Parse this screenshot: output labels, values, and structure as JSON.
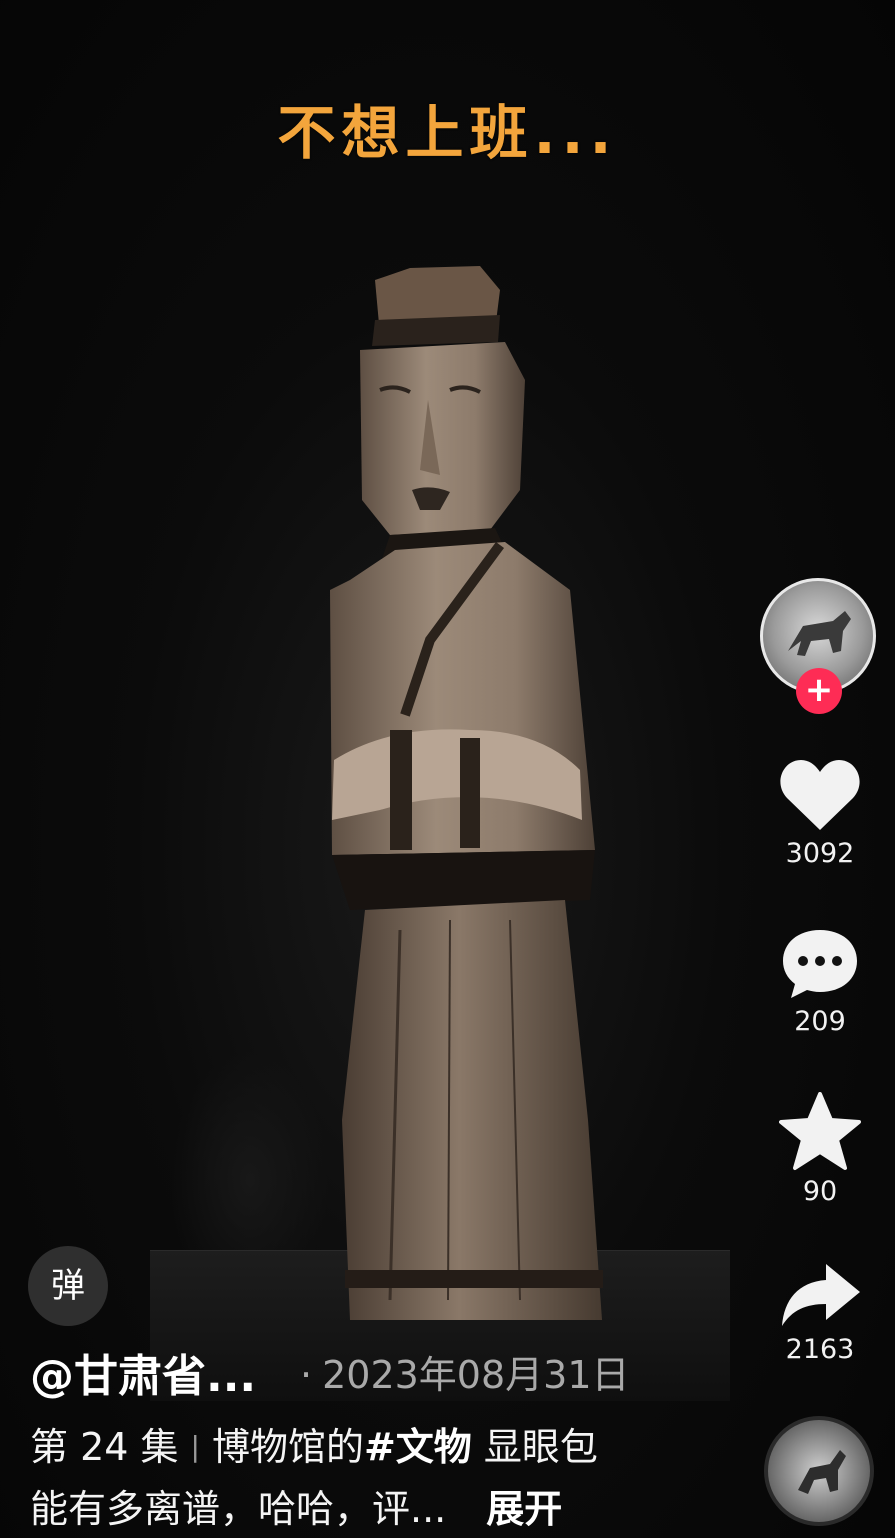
{
  "video": {
    "caption": "不想上班..."
  },
  "actions": {
    "follow_symbol": "+",
    "likes": "3092",
    "comments": "209",
    "favorites": "90",
    "shares": "2163"
  },
  "info": {
    "danmu_label": "弹",
    "author": "@甘肃省...",
    "date": "2023年08月31日",
    "episode": "第 24 集",
    "desc_part1": "博物馆的",
    "hashtag": "#文物",
    "desc_part2": " 显眼包",
    "desc_line2": "能有多离谱，哈哈，评...",
    "expand_label": "展开"
  },
  "icons": {
    "like": "heart-icon",
    "comment": "comment-bubble-icon",
    "favorite": "star-icon",
    "share": "share-arrow-icon",
    "music": "music-disc-icon"
  },
  "colors": {
    "caption": "#f3a53c",
    "follow": "#fe2c55",
    "background": "#070707"
  }
}
